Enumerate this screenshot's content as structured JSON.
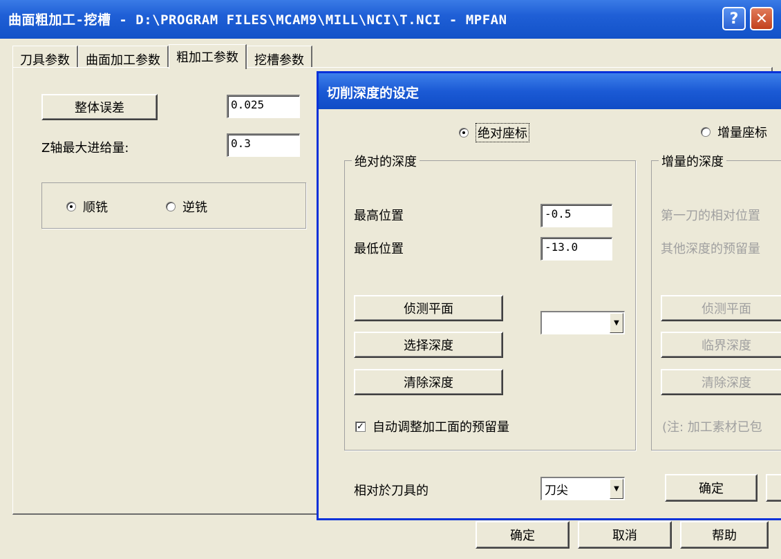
{
  "window": {
    "title": "曲面粗加工-挖槽 - D:\\PROGRAM FILES\\MCAM9\\MILL\\NCI\\T.NCI - MPFAN",
    "help_glyph": "?",
    "close_glyph": "✕"
  },
  "tabs": [
    "刀具参数",
    "曲面加工参数",
    "粗加工参数",
    "挖槽参数"
  ],
  "main": {
    "tolerance_button": "整体误差",
    "tolerance_value": "0.025",
    "z_step_label": "Z轴最大进给量:",
    "z_step_value": "0.3",
    "climb_label": "顺铣",
    "conventional_label": "逆铣",
    "ok_button": "确定",
    "cancel_button": "取消",
    "help_button": "帮助"
  },
  "dialog": {
    "title": "切削深度的设定",
    "absolute_radio": "绝对座标",
    "incremental_radio": "增量座标",
    "absolute_group": {
      "legend": "绝对的深度",
      "top_label": "最高位置",
      "top_value": "-0.5",
      "bottom_label": "最低位置",
      "bottom_value": "-13.0",
      "detect_button": "侦测平面",
      "select_button": "选择深度",
      "clear_button": "清除深度",
      "auto_adjust_label": "自动调整加工面的预留量",
      "auto_adjust_checked": true
    },
    "incremental_group": {
      "legend": "增量的深度",
      "first_cut_label": "第一刀的相对位置",
      "other_label": "其他深度的预留量",
      "detect_button": "侦测平面",
      "critical_button": "临界深度",
      "clear_button": "清除深度",
      "note": "(注: 加工素材已包"
    },
    "relative_label": "相对於刀具的",
    "relative_value": "刀尖",
    "ok_button": "确定"
  }
}
